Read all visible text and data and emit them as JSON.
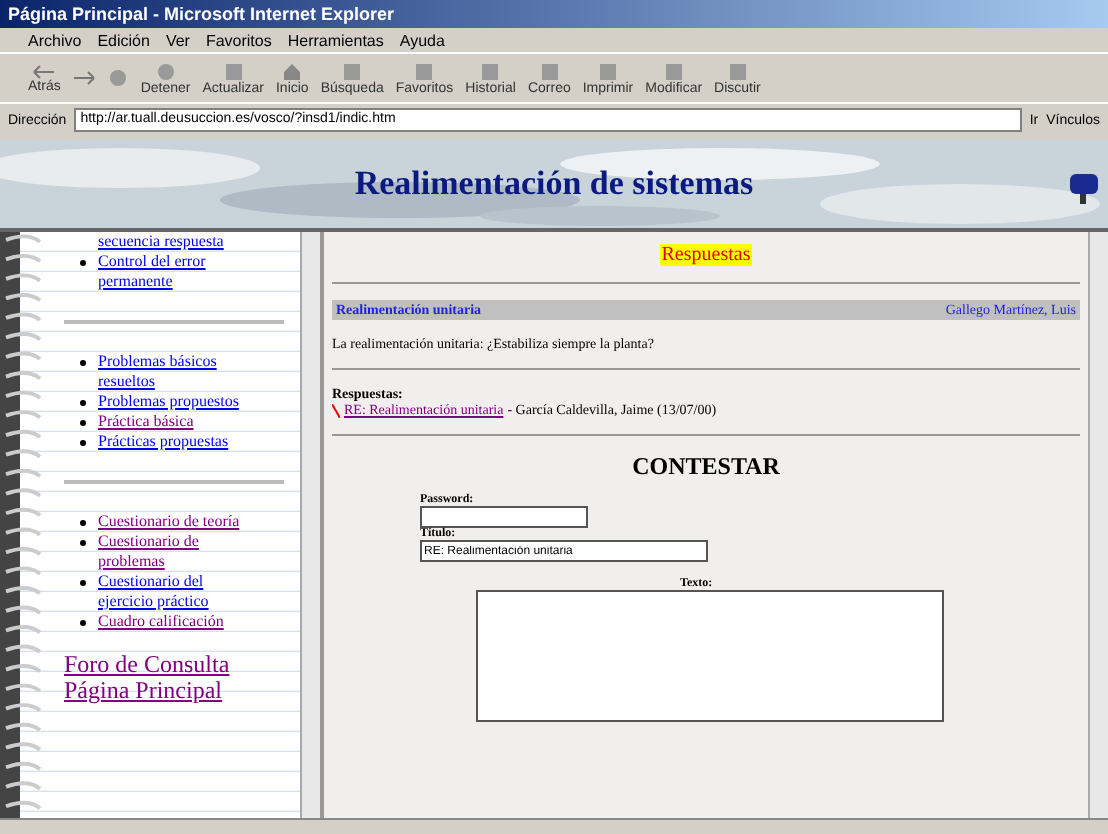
{
  "window": {
    "title": "Página Principal - Microsoft Internet Explorer"
  },
  "menu": [
    "Archivo",
    "Edición",
    "Ver",
    "Favoritos",
    "Herramientas",
    "Ayuda"
  ],
  "toolbar": [
    {
      "label": "Atrás",
      "kind": "back"
    },
    {
      "kind": "forward"
    },
    {
      "kind": "stop"
    },
    {
      "label": "Detener",
      "kind": "stop2"
    },
    {
      "label": "Actualizar",
      "kind": "refresh"
    },
    {
      "label": "Inicio",
      "kind": "home"
    },
    {
      "label": "Búsqueda",
      "kind": "search"
    },
    {
      "label": "Favoritos",
      "kind": "star"
    },
    {
      "label": "Historial",
      "kind": "history"
    },
    {
      "label": "Correo",
      "kind": "mail"
    },
    {
      "label": "Imprimir",
      "kind": "print"
    },
    {
      "label": "Modificar",
      "kind": "edit"
    },
    {
      "label": "Discutir",
      "kind": "discuss"
    }
  ],
  "address": {
    "label": "Dirección",
    "value": "http://ar.tuall.deusuccion.es/vosco/?insd1/indic.htm",
    "go": "Ir",
    "links": "Vínculos"
  },
  "banner": {
    "title": "Realimentación de sistemas"
  },
  "sidebar": {
    "groups": [
      [
        {
          "label": "secuencia respuesta",
          "visited": false,
          "bullet": false
        },
        {
          "label": "Control del error permanente",
          "visited": false,
          "bullet": true
        }
      ],
      [
        {
          "label": "Problemas básicos resueltos",
          "visited": false,
          "bullet": true
        },
        {
          "label": "Problemas propuestos",
          "visited": false,
          "bullet": true
        },
        {
          "label": "Práctica básica",
          "visited": true,
          "bullet": true
        },
        {
          "label": "Prácticas propuestas",
          "visited": false,
          "bullet": true
        }
      ],
      [
        {
          "label": "Cuestionario de teoría",
          "visited": true,
          "bullet": true
        },
        {
          "label": "Cuestionario de problemas",
          "visited": true,
          "bullet": true
        },
        {
          "label": "Cuestionario del ejercicio práctico",
          "visited": false,
          "bullet": true
        },
        {
          "label": "Cuadro calificación",
          "visited": true,
          "bullet": true
        }
      ]
    ],
    "big_links": [
      "Foro de Consulta",
      "Página Principal"
    ]
  },
  "main": {
    "heading": "Respuestas",
    "topic": "Realimentación unitaria",
    "author": "Gallego Martínez, Luis",
    "message": "La realimentación unitaria: ¿Estabiliza siempre la planta?",
    "replies_label": "Respuestas:",
    "replies": [
      {
        "link": "RE: Realimentación unitaria",
        "by": "- García Caldevilla, Jaime (13/07/00)"
      }
    ],
    "form": {
      "title": "CONTESTAR",
      "password_label": "Password:",
      "title_label": "Título:",
      "title_value": "RE: Realimentación unitaria",
      "text_label": "Texto:"
    }
  }
}
